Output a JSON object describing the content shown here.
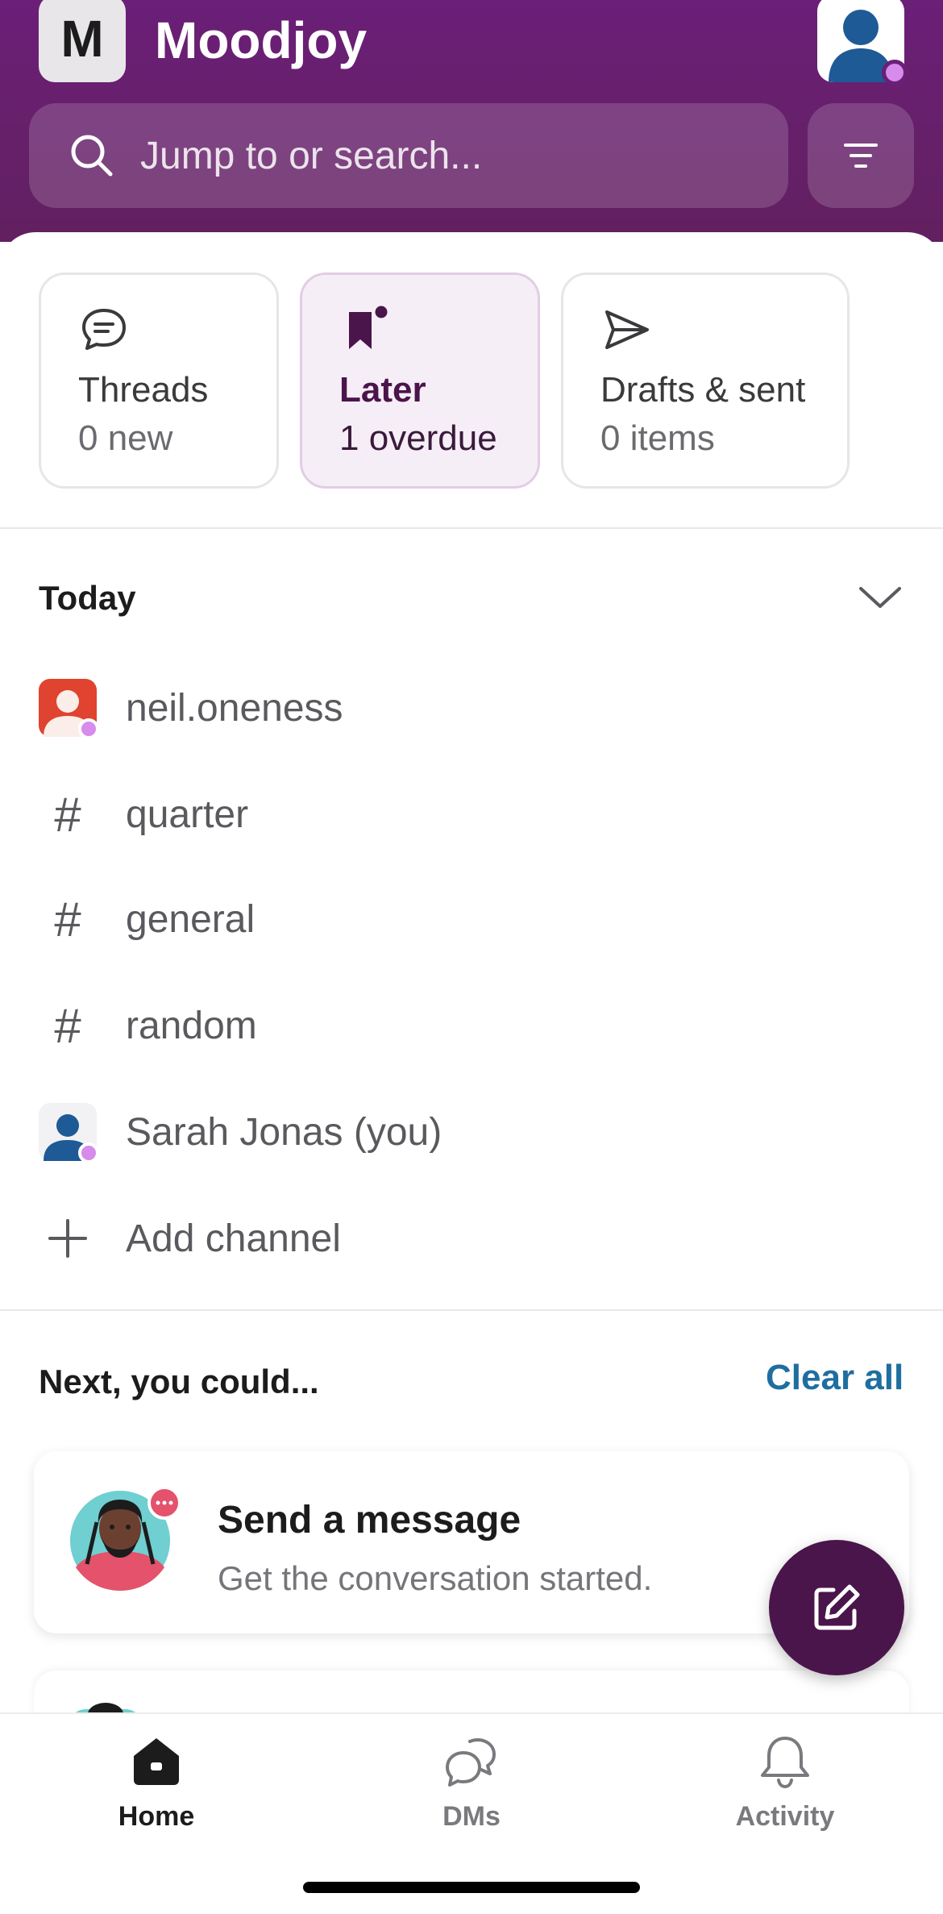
{
  "header": {
    "workspace_initial": "M",
    "workspace_name": "Moodjoy",
    "search_placeholder": "Jump to or search..."
  },
  "cards": [
    {
      "title": "Threads",
      "subtitle": "0 new"
    },
    {
      "title": "Later",
      "subtitle": "1 overdue"
    },
    {
      "title": "Drafts & sent",
      "subtitle": "0 items"
    }
  ],
  "today": {
    "title": "Today",
    "items": [
      {
        "label": "neil.oneness",
        "type": "dm"
      },
      {
        "label": "quarter",
        "type": "channel"
      },
      {
        "label": "general",
        "type": "channel"
      },
      {
        "label": "random",
        "type": "channel"
      },
      {
        "label": "Sarah Jonas (you)",
        "type": "dm"
      },
      {
        "label": "Add channel",
        "type": "add"
      }
    ]
  },
  "next": {
    "title": "Next, you could...",
    "clear_all": "Clear all",
    "suggestion_title": "Send a message",
    "suggestion_sub": "Get the conversation started."
  },
  "nav": [
    {
      "label": "Home",
      "icon": "home-icon",
      "active": true
    },
    {
      "label": "DMs",
      "icon": "dms-icon",
      "active": false
    },
    {
      "label": "Activity",
      "icon": "bell-icon",
      "active": false
    }
  ],
  "colors": {
    "header_purple": "#6b1f78",
    "accent": "#4a154b",
    "link_blue": "#1f6ea0",
    "presence": "#d78bea"
  }
}
